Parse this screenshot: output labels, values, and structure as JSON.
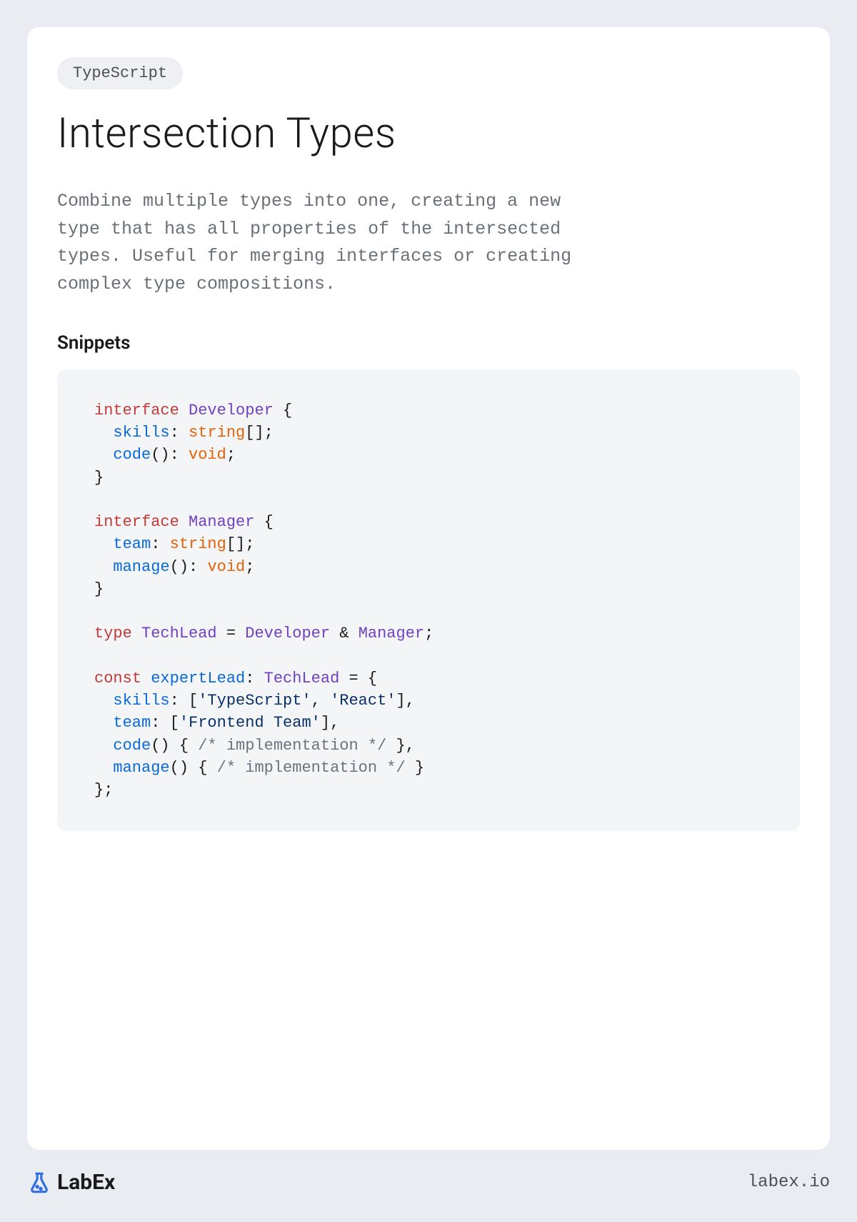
{
  "badge": "TypeScript",
  "title": "Intersection Types",
  "description": "Combine multiple types into one, creating a new type that has all properties of the intersected types. Useful for merging interfaces or creating complex type compositions.",
  "snippets_heading": "Snippets",
  "code": {
    "tokens": [
      {
        "t": "interface",
        "c": "kw"
      },
      {
        "t": " "
      },
      {
        "t": "Developer",
        "c": "type"
      },
      {
        "t": " {"
      },
      {
        "t": "\n"
      },
      {
        "t": "  "
      },
      {
        "t": "skills",
        "c": "prop"
      },
      {
        "t": ": "
      },
      {
        "t": "string",
        "c": "builtin"
      },
      {
        "t": "[];"
      },
      {
        "t": "\n"
      },
      {
        "t": "  "
      },
      {
        "t": "code",
        "c": "prop"
      },
      {
        "t": "(): "
      },
      {
        "t": "void",
        "c": "builtin"
      },
      {
        "t": ";"
      },
      {
        "t": "\n"
      },
      {
        "t": "}"
      },
      {
        "t": "\n"
      },
      {
        "t": "\n"
      },
      {
        "t": "interface",
        "c": "kw"
      },
      {
        "t": " "
      },
      {
        "t": "Manager",
        "c": "type"
      },
      {
        "t": " {"
      },
      {
        "t": "\n"
      },
      {
        "t": "  "
      },
      {
        "t": "team",
        "c": "prop"
      },
      {
        "t": ": "
      },
      {
        "t": "string",
        "c": "builtin"
      },
      {
        "t": "[];"
      },
      {
        "t": "\n"
      },
      {
        "t": "  "
      },
      {
        "t": "manage",
        "c": "prop"
      },
      {
        "t": "(): "
      },
      {
        "t": "void",
        "c": "builtin"
      },
      {
        "t": ";"
      },
      {
        "t": "\n"
      },
      {
        "t": "}"
      },
      {
        "t": "\n"
      },
      {
        "t": "\n"
      },
      {
        "t": "type",
        "c": "kw"
      },
      {
        "t": " "
      },
      {
        "t": "TechLead",
        "c": "type"
      },
      {
        "t": " = "
      },
      {
        "t": "Developer",
        "c": "type"
      },
      {
        "t": " & "
      },
      {
        "t": "Manager",
        "c": "type"
      },
      {
        "t": ";"
      },
      {
        "t": "\n"
      },
      {
        "t": "\n"
      },
      {
        "t": "const",
        "c": "kw"
      },
      {
        "t": " "
      },
      {
        "t": "expertLead",
        "c": "prop"
      },
      {
        "t": ": "
      },
      {
        "t": "TechLead",
        "c": "type"
      },
      {
        "t": " = {"
      },
      {
        "t": "\n"
      },
      {
        "t": "  "
      },
      {
        "t": "skills",
        "c": "prop"
      },
      {
        "t": ": ["
      },
      {
        "t": "'TypeScript'",
        "c": "str"
      },
      {
        "t": ", "
      },
      {
        "t": "'React'",
        "c": "str"
      },
      {
        "t": "],"
      },
      {
        "t": "\n"
      },
      {
        "t": "  "
      },
      {
        "t": "team",
        "c": "prop"
      },
      {
        "t": ": ["
      },
      {
        "t": "'Frontend Team'",
        "c": "str"
      },
      {
        "t": "],"
      },
      {
        "t": "\n"
      },
      {
        "t": "  "
      },
      {
        "t": "code",
        "c": "prop"
      },
      {
        "t": "() { "
      },
      {
        "t": "/* implementation */",
        "c": "comment"
      },
      {
        "t": " },"
      },
      {
        "t": "\n"
      },
      {
        "t": "  "
      },
      {
        "t": "manage",
        "c": "prop"
      },
      {
        "t": "() { "
      },
      {
        "t": "/* implementation */",
        "c": "comment"
      },
      {
        "t": " }"
      },
      {
        "t": "\n"
      },
      {
        "t": "};"
      }
    ]
  },
  "brand": "LabEx",
  "url": "labex.io",
  "colors": {
    "kw": "#c13b3a",
    "type": "#6f42c1",
    "prop": "#0969da",
    "builtin": "#e36209",
    "str": "#0a3069",
    "comment": "#6a737d",
    "brand_accent": "#2e6be6"
  }
}
